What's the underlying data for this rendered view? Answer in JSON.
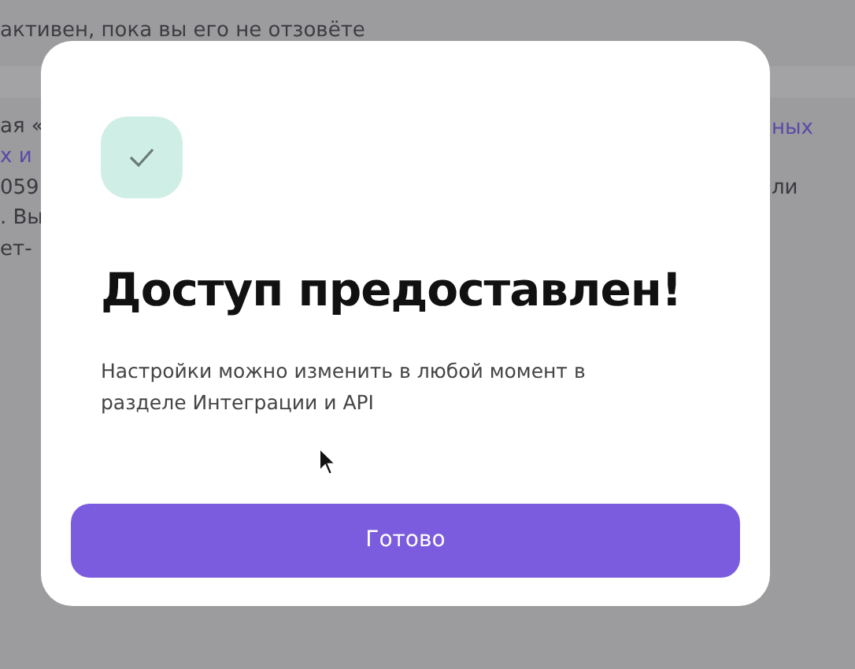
{
  "background_page": {
    "notice": "активен, пока вы его не отзовёте",
    "left_fragments": [
      {
        "text": "ая «",
        "link": false
      },
      {
        "text": "х и",
        "link": true
      },
      {
        "text": "059",
        "link": false
      },
      {
        "text": ". Вы",
        "link": false
      },
      {
        "text": "ет-",
        "link": false
      }
    ],
    "right_fragments": [
      {
        "text": "ных",
        "link": true
      },
      {
        "text": "ли",
        "link": false
      }
    ]
  },
  "dialog": {
    "title": "Доступ предоставлен!",
    "message": "Настройки можно изменить в любой момент в разделе Интеграции и API",
    "button": "Готово"
  }
}
